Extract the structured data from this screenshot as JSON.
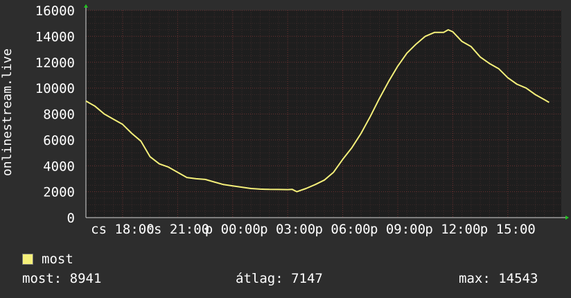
{
  "chart_data": {
    "type": "line",
    "ylabel": "onlinestream.live",
    "ylim": [
      0,
      16000
    ],
    "y_ticks": [
      "0",
      "2000",
      "4000",
      "6000",
      "8000",
      "10000",
      "12000",
      "14000",
      "16000"
    ],
    "x_ticks": [
      "cs 18:00",
      "cs 21:00",
      "p 00:00",
      "p 03:00",
      "p 06:00",
      "p 09:00",
      "p 12:00",
      "p 15:00"
    ],
    "grid": true,
    "legend_position": "bottom-left",
    "series": [
      {
        "name": "most",
        "color": "#f5f07a",
        "values": [
          [
            "cs 16:00",
            9000
          ],
          [
            "cs 16:30",
            8600
          ],
          [
            "cs 17:00",
            8000
          ],
          [
            "cs 17:30",
            7600
          ],
          [
            "cs 18:00",
            7200
          ],
          [
            "cs 18:30",
            6500
          ],
          [
            "cs 19:00",
            5900
          ],
          [
            "cs 19:30",
            4700
          ],
          [
            "cs 20:00",
            4150
          ],
          [
            "cs 20:30",
            3900
          ],
          [
            "cs 21:00",
            3500
          ],
          [
            "cs 21:30",
            3100
          ],
          [
            "cs 22:00",
            3000
          ],
          [
            "cs 22:30",
            2950
          ],
          [
            "cs 23:00",
            2750
          ],
          [
            "cs 23:30",
            2550
          ],
          [
            "p 00:00",
            2450
          ],
          [
            "p 00:30",
            2350
          ],
          [
            "p 01:00",
            2250
          ],
          [
            "p 01:30",
            2200
          ],
          [
            "p 02:00",
            2180
          ],
          [
            "p 02:30",
            2170
          ],
          [
            "p 03:00",
            2160
          ],
          [
            "p 03:15",
            2180
          ],
          [
            "p 03:30",
            2000
          ],
          [
            "p 04:00",
            2250
          ],
          [
            "p 04:30",
            2550
          ],
          [
            "p 05:00",
            2900
          ],
          [
            "p 05:30",
            3500
          ],
          [
            "p 06:00",
            4500
          ],
          [
            "p 06:30",
            5400
          ],
          [
            "p 07:00",
            6500
          ],
          [
            "p 07:30",
            7800
          ],
          [
            "p 08:00",
            9200
          ],
          [
            "p 08:30",
            10500
          ],
          [
            "p 09:00",
            11700
          ],
          [
            "p 09:30",
            12700
          ],
          [
            "p 10:00",
            13400
          ],
          [
            "p 10:30",
            14000
          ],
          [
            "p 11:00",
            14300
          ],
          [
            "p 11:30",
            14300
          ],
          [
            "p 11:45",
            14500
          ],
          [
            "p 12:00",
            14350
          ],
          [
            "p 12:30",
            13600
          ],
          [
            "p 13:00",
            13200
          ],
          [
            "p 13:30",
            12400
          ],
          [
            "p 14:00",
            11900
          ],
          [
            "p 14:30",
            11500
          ],
          [
            "p 15:00",
            10800
          ],
          [
            "p 15:30",
            10300
          ],
          [
            "p 16:00",
            10000
          ],
          [
            "p 16:30",
            9500
          ],
          [
            "p 17:00",
            9100
          ],
          [
            "p 17:15",
            8900
          ]
        ]
      }
    ]
  },
  "legend": {
    "label": "most",
    "color": "#f5f07a"
  },
  "stats": {
    "current": "most: 8941",
    "average": "átlag: 7147",
    "max": "max: 14543"
  }
}
